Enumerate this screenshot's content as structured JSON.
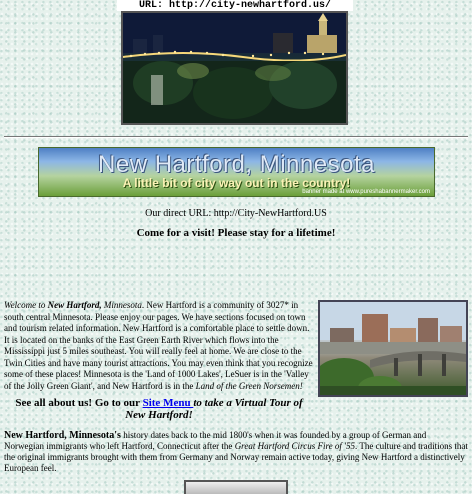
{
  "url_bar": {
    "text": "URL: http://city-newhartford.us/"
  },
  "banner": {
    "title": "New Hartford, Minnesota",
    "tagline": "A little bit of city way out in the country!",
    "credit": "banner made at www.pureshabannermaker.com"
  },
  "direct_url": "Our direct URL: http://City-NewHartford.US",
  "tagline": "Come for a visit! Please stay for a lifetime!",
  "intro": {
    "welcome": "Welcome to ",
    "town": "New Hartford,",
    "state": " Minnesota",
    "text": ". New Hartford is a community of 3027* in south central Minnesota. Please enjoy our pages. We have sections focused on town and tourism related information. New Hartford is a comfortable place to settle down. It is located on the banks of the East Green Earth River which flows into the Mississippi just 5 miles southeast. You will really feel at home. We are close to the Twin Cities and have many tourist attractions. You may even think that you recognize some of these places! Minnesota is the 'Land of 1000 Lakes', LeSuer is in the 'Valley of the Jolly Green Giant', and New Hartford is in the ",
    "land": "Land of the Green Norsemen!"
  },
  "see_all": {
    "prefix": "See all about us! Go to our ",
    "link": "Site Menu ",
    "suffix": "to take a Virtual Tour of New Hartford!"
  },
  "history": {
    "lead": "New Hartford, Minnesota's",
    "text1": " history dates back to the mid 1800's when it was founded by a group of German and Norwegian immigrants who left Hartford, Connecticut after the ",
    "fire": "Great Hartford Circus Fire of '55",
    "text2": ". The culture and traditions that the original immigrants brought with them from Germany and Norway remain active today, giving New Hartford a distinctively European feel."
  },
  "colors": {
    "link": "#0000ee",
    "background": "#e6f1ec"
  }
}
